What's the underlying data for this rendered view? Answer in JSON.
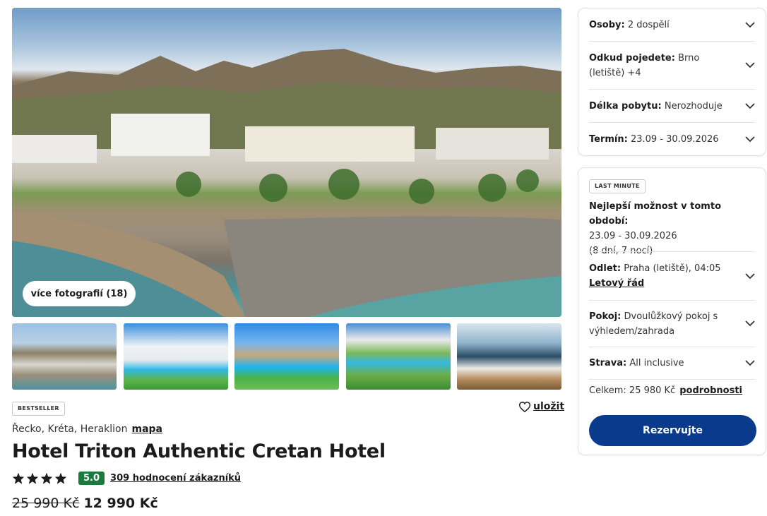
{
  "gallery": {
    "more_photos_label": "více fotografií (18)"
  },
  "hotel": {
    "bestseller_badge": "BESTSELLER",
    "save_label": "uložit",
    "location": "Řecko, Kréta, Heraklion",
    "map_link": "mapa",
    "name": "Hotel Triton Authentic Cretan Hotel",
    "stars": 4,
    "score": "5.0",
    "score_color": "#1d7a3e",
    "reviews_link": "309 hodnocení zákazníků",
    "price_old": "25 990 Kč",
    "price_new": "12 990 Kč"
  },
  "filters": {
    "persons": {
      "label": "Osoby:",
      "value": "2 dospělí"
    },
    "departure_from": {
      "label": "Odkud pojedete:",
      "value": "Brno (letiště) +4"
    },
    "stay_length": {
      "label": "Délka pobytu:",
      "value": "Nerozhoduje"
    },
    "term": {
      "label": "Termín:",
      "value": "23.09 - 30.09.2026"
    }
  },
  "offer": {
    "badge": "LAST MINUTE",
    "best_title": "Nejlepší možnost v tomto období:",
    "best_dates": "23.09 - 30.09.2026",
    "best_duration": "(8 dní, 7 nocí)",
    "departure": {
      "label": "Odlet:",
      "value": "Praha (letiště), 04:05",
      "link": "Letový řád"
    },
    "room": {
      "label": "Pokoj:",
      "value": "Dvoulůžkový pokoj s výhledem/zahrada"
    },
    "board": {
      "label": "Strava:",
      "value": "All inclusive"
    },
    "total_label": "Celkem: 25 980 Kč",
    "details_link": "podrobnosti",
    "reserve_label": "Rezervujte",
    "reserve_color": "#0a3a8c"
  }
}
